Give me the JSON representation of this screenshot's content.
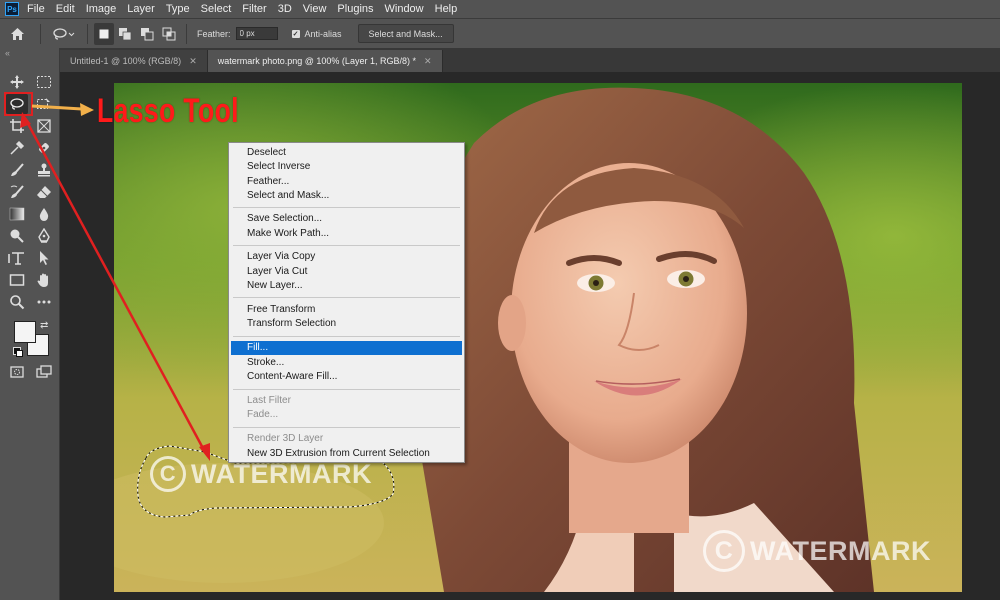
{
  "menubar": {
    "logo": "Ps",
    "items": [
      "File",
      "Edit",
      "Image",
      "Layer",
      "Type",
      "Select",
      "Filter",
      "3D",
      "View",
      "Plugins",
      "Window",
      "Help"
    ]
  },
  "options_bar": {
    "feather_label": "Feather:",
    "feather_value": "0 px",
    "antialias_label": "Anti-alias",
    "antialias_checked": true,
    "select_mask_label": "Select and Mask..."
  },
  "tabs": [
    {
      "label": "Untitled-1 @ 100% (RGB/8)",
      "active": false
    },
    {
      "label": "watermark photo.png @ 100% (Layer 1, RGB/8) *",
      "active": true
    }
  ],
  "toolbar": {
    "active_tool": "lasso-tool",
    "tools": [
      "move",
      "marquee",
      "lasso",
      "object-select",
      "crop",
      "frame",
      "eyedropper",
      "healing",
      "brush",
      "stamp",
      "history-brush",
      "eraser",
      "gradient",
      "blur",
      "dodge",
      "pen",
      "type",
      "path-select",
      "rectangle",
      "hand",
      "zoom",
      "more"
    ]
  },
  "context_menu": {
    "groups": [
      [
        {
          "label": "Deselect",
          "state": "normal"
        },
        {
          "label": "Select Inverse",
          "state": "normal"
        },
        {
          "label": "Feather...",
          "state": "normal"
        },
        {
          "label": "Select and Mask...",
          "state": "normal"
        }
      ],
      [
        {
          "label": "Save Selection...",
          "state": "normal"
        },
        {
          "label": "Make Work Path...",
          "state": "normal"
        }
      ],
      [
        {
          "label": "Layer Via Copy",
          "state": "normal"
        },
        {
          "label": "Layer Via Cut",
          "state": "normal"
        },
        {
          "label": "New Layer...",
          "state": "normal"
        }
      ],
      [
        {
          "label": "Free Transform",
          "state": "normal"
        },
        {
          "label": "Transform Selection",
          "state": "normal"
        }
      ],
      [
        {
          "label": "Fill...",
          "state": "highlighted"
        },
        {
          "label": "Stroke...",
          "state": "normal"
        },
        {
          "label": "Content-Aware Fill...",
          "state": "normal"
        }
      ],
      [
        {
          "label": "Last Filter",
          "state": "disabled"
        },
        {
          "label": "Fade...",
          "state": "disabled"
        }
      ],
      [
        {
          "label": "Render 3D Layer",
          "state": "disabled"
        },
        {
          "label": "New 3D Extrusion from Current Selection",
          "state": "normal"
        }
      ]
    ]
  },
  "annotation": {
    "label": "Lasso Tool",
    "color": "#ff1a1a",
    "arrow_color": "#f2b04a"
  },
  "watermarks": {
    "symbol": "C",
    "text": "WATERMARK"
  },
  "colors": {
    "highlight": "#0e6fd0",
    "ui_dark": "#535353",
    "canvas_bg": "#282828"
  }
}
